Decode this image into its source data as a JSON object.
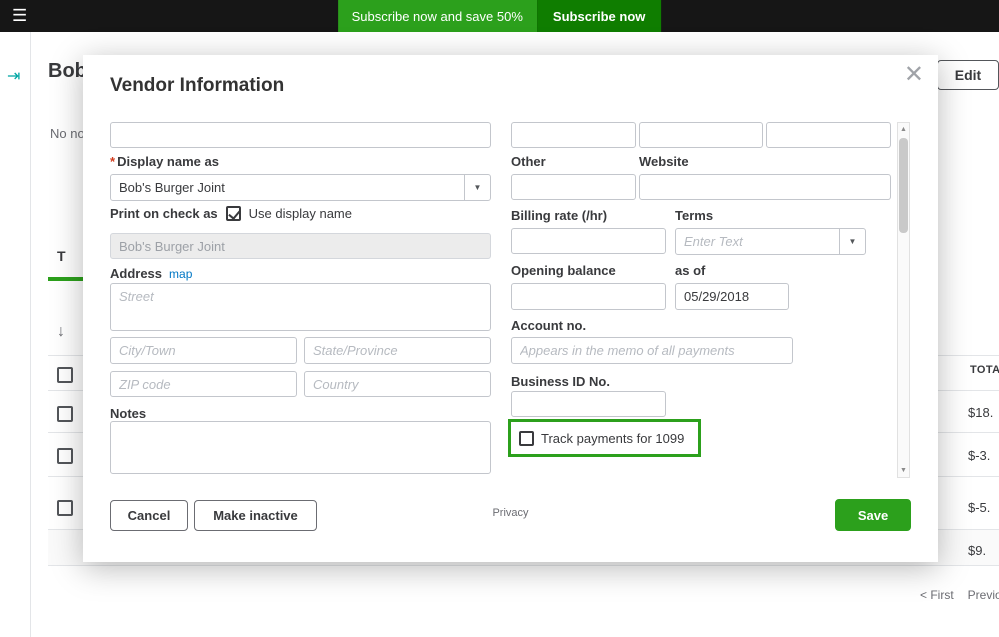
{
  "icons": {
    "hamburger": "☰",
    "close": "✕",
    "dropdown": "▼",
    "sort_down": "↓",
    "collapse": "⇥",
    "scroll_up": "▲",
    "scroll_down": "▼"
  },
  "topbar": {
    "banner_text": "Subscribe now and save 50%",
    "banner_button_label": "Subscribe now"
  },
  "background": {
    "page_title": "Bob",
    "edit_button_label": "Edit",
    "note_fragment": "No no",
    "tab_fragment": "T",
    "table": {
      "total_header": "TOTA",
      "rows": [
        "$18.",
        "$-3.",
        "$-5.",
        "$9."
      ],
      "pagination_first": "< First",
      "pagination_previous": "Previo"
    }
  },
  "modal": {
    "title": "Vendor Information",
    "display_name": {
      "required_mark": "*",
      "label": "Display name as",
      "value": "Bob's Burger Joint"
    },
    "print_on_check": {
      "label": "Print on check as",
      "checkbox_label": "Use display name",
      "value": "Bob's Burger Joint"
    },
    "address": {
      "label": "Address",
      "map_link": "map",
      "street_placeholder": "Street",
      "city_placeholder": "City/Town",
      "state_placeholder": "State/Province",
      "zip_placeholder": "ZIP code",
      "country_placeholder": "Country"
    },
    "notes_label": "Notes",
    "other_label": "Other",
    "website_label": "Website",
    "billing_rate_label": "Billing rate (/hr)",
    "terms": {
      "label": "Terms",
      "placeholder": "Enter Text"
    },
    "opening_balance_label": "Opening balance",
    "as_of": {
      "label": "as of",
      "value": "05/29/2018"
    },
    "account_no": {
      "label": "Account no.",
      "placeholder": "Appears in the memo of all payments"
    },
    "business_id_label": "Business ID No.",
    "track_1099_label": "Track payments for 1099",
    "footer": {
      "cancel_label": "Cancel",
      "make_inactive_label": "Make inactive",
      "privacy_label": "Privacy",
      "save_label": "Save"
    }
  },
  "colors": {
    "qb_green": "#2ca01c",
    "banner_button_green": "#0f7d00",
    "link_blue": "#0077c5",
    "required_red": "#d13c1e",
    "topbar_black": "#161616"
  }
}
